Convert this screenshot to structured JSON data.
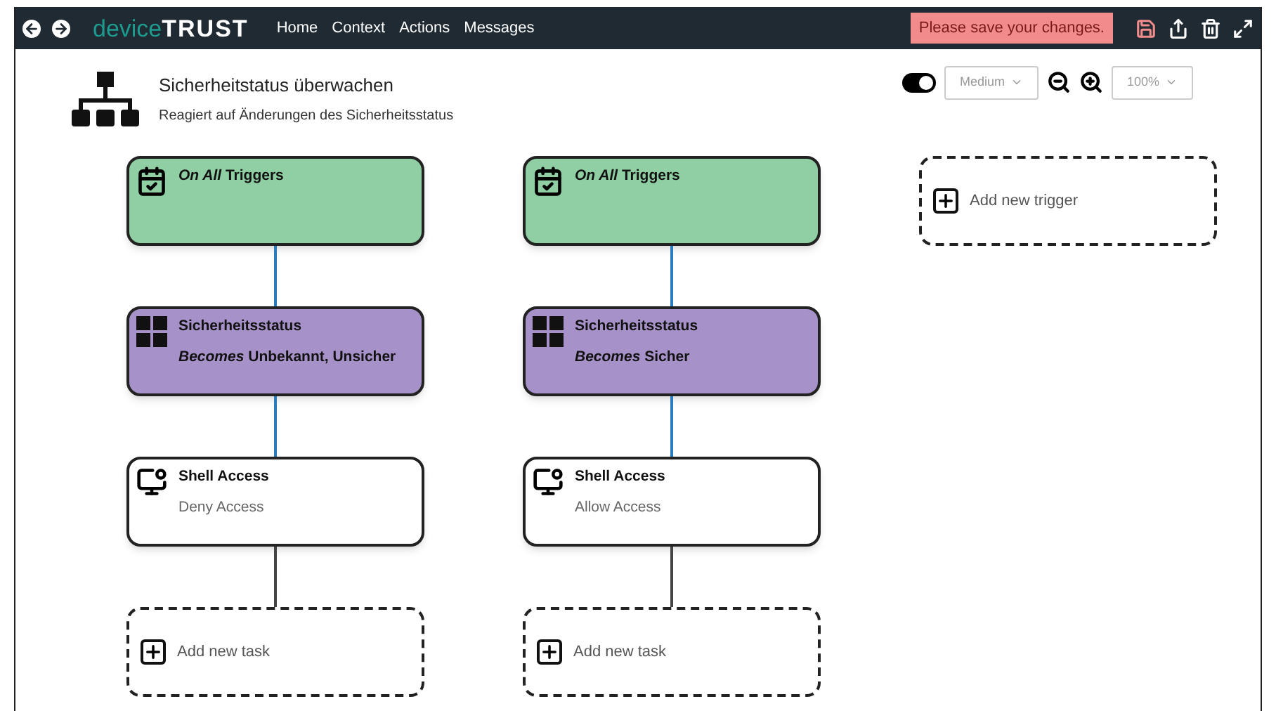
{
  "topbar": {
    "brand_light": "device",
    "brand_bold": "TRUST",
    "nav": [
      "Home",
      "Context",
      "Actions",
      "Messages"
    ],
    "notice": "Please save your changes."
  },
  "header": {
    "title": "Sicherheitstatus überwachen",
    "subtitle": "Reagiert auf Änderungen des Sicherheitsstatus"
  },
  "toolbar": {
    "toggle_on": true,
    "size": "Medium",
    "zoom": "100%"
  },
  "columns": [
    {
      "nodes": [
        {
          "kind": "trigger",
          "title": "*On All* Triggers"
        },
        {
          "kind": "condition",
          "title": "Sicherheitsstatus",
          "detail": "*Becomes* Unbekannt, Unsicher"
        },
        {
          "kind": "action",
          "title": "Shell Access",
          "detail": "Deny Access"
        },
        {
          "kind": "add",
          "title": "Add new task"
        }
      ]
    },
    {
      "nodes": [
        {
          "kind": "trigger",
          "title": "*On All* Triggers"
        },
        {
          "kind": "condition",
          "title": "Sicherheitsstatus",
          "detail": "*Becomes* Sicher"
        },
        {
          "kind": "action",
          "title": "Shell Access",
          "detail": "Allow Access"
        },
        {
          "kind": "add",
          "title": "Add new task"
        }
      ]
    },
    {
      "nodes": [
        {
          "kind": "add",
          "title": "Add new trigger"
        }
      ]
    }
  ]
}
